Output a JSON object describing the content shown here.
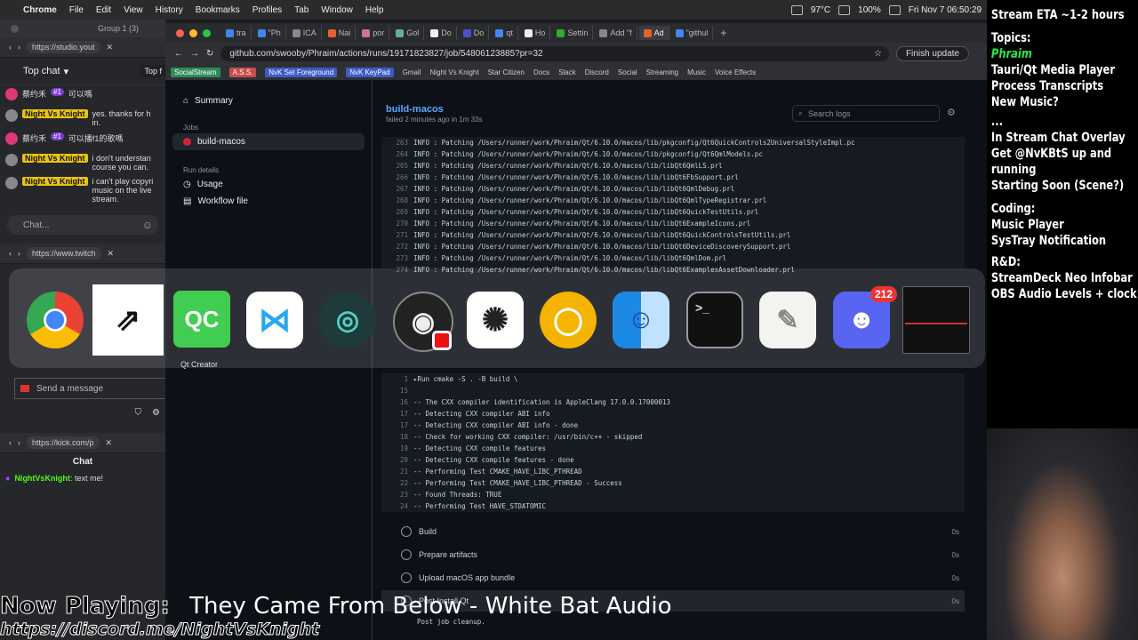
{
  "menubar": {
    "items": [
      "Chrome",
      "File",
      "Edit",
      "View",
      "History",
      "Bookmarks",
      "Profiles",
      "Tab",
      "Window",
      "Help"
    ],
    "temp": "97°C",
    "battery": "100%",
    "datetime": "Fri Nov 7  06:50:29"
  },
  "left": {
    "group_label": "Group 1 (3)",
    "url1": "https://studio.yout",
    "top_chat": "Top chat",
    "top_chat2": "Top f",
    "chat_msgs": [
      {
        "user": "蔡约禾",
        "badge": "#1",
        "text": "可以嗎"
      },
      {
        "user": "Night Vs Knight",
        "text": "yes. thanks for h in."
      },
      {
        "user": "蔡约禾",
        "badge": "#1",
        "text": "可以播f1的歌嗎"
      },
      {
        "user": "Night Vs Knight",
        "text": "i don't understan course you can."
      },
      {
        "user": "Night Vs Knight",
        "text": "i can't play copyri music on the live stream."
      }
    ],
    "chat_placeholder": "Chat...",
    "url2": "https://www.twitch",
    "send_placeholder": "Send a message",
    "url3": "https://kick.com/p",
    "kick_chat_title": "Chat",
    "kick_user": "NightVsKnight",
    "kick_msg": ": text me!"
  },
  "tabs": [
    "tra",
    "\"Ph",
    "ICA",
    "Nai",
    "por",
    "Gol",
    "Do",
    "Do",
    "qt",
    "Ho",
    "Settin",
    "Add \"f",
    "Ad",
    "\"githul"
  ],
  "address": {
    "url": "github.com/swooby/Phraim/actions/runs/19171823827/job/54806123885?pr=32",
    "finish_update": "Finish update"
  },
  "bookmarks": [
    "SocialStream",
    "A.S.S.",
    "NvK Set Foreground",
    "NvK KeyPad",
    "Gmail",
    "Night Vs Knight",
    "Star Citizen",
    "Docs",
    "Slack",
    "Discord",
    "Social",
    "Streaming",
    "Music",
    "Voice Effects"
  ],
  "gh": {
    "summary": "Summary",
    "jobs_heading": "Jobs",
    "job_name": "build-macos",
    "run_details": "Run details",
    "usage": "Usage",
    "workflow_file": "Workflow file",
    "job_title": "build-macos",
    "job_sub": "failed 2 minutes ago in 1m 33s",
    "search_placeholder": "Search logs",
    "log_top": [
      {
        "n": "263",
        "t": "INFO    : Patching /Users/runner/work/Phraim/Qt/6.10.0/macos/lib/pkgconfig/Qt6QuickControls2UniversalStyleImpl.pc"
      },
      {
        "n": "264",
        "t": "INFO    : Patching /Users/runner/work/Phraim/Qt/6.10.0/macos/lib/pkgconfig/Qt6QmlModels.pc"
      },
      {
        "n": "265",
        "t": "INFO    : Patching /Users/runner/work/Phraim/Qt/6.10.0/macos/lib/libQt6QmlLS.prl"
      },
      {
        "n": "266",
        "t": "INFO    : Patching /Users/runner/work/Phraim/Qt/6.10.0/macos/lib/libQt6FbSupport.prl"
      },
      {
        "n": "267",
        "t": "INFO    : Patching /Users/runner/work/Phraim/Qt/6.10.0/macos/lib/libQt6QmlDebug.prl"
      },
      {
        "n": "268",
        "t": "INFO    : Patching /Users/runner/work/Phraim/Qt/6.10.0/macos/lib/libQt6QmlTypeRegistrar.prl"
      },
      {
        "n": "269",
        "t": "INFO    : Patching /Users/runner/work/Phraim/Qt/6.10.0/macos/lib/libQt6QuickTestUtils.prl"
      },
      {
        "n": "270",
        "t": "INFO    : Patching /Users/runner/work/Phraim/Qt/6.10.0/macos/lib/libQt6ExampleIcons.prl"
      },
      {
        "n": "271",
        "t": "INFO    : Patching /Users/runner/work/Phraim/Qt/6.10.0/macos/lib/libQt6QuickControlsTestUtils.prl"
      },
      {
        "n": "272",
        "t": "INFO    : Patching /Users/runner/work/Phraim/Qt/6.10.0/macos/lib/libQt6DeviceDiscoverySupport.prl"
      },
      {
        "n": "273",
        "t": "INFO    : Patching /Users/runner/work/Phraim/Qt/6.10.0/macos/lib/libQt6QmlDom.prl"
      },
      {
        "n": "274",
        "t": "INFO    : Patching /Users/runner/work/Phraim/Qt/6.10.0/macos/lib/libQt6ExamplesAssetDownloader.prl"
      }
    ],
    "log_bottom": [
      {
        "n": "1",
        "t": "▸Run cmake -S . -B build \\"
      },
      {
        "n": "15",
        "t": ""
      },
      {
        "n": "16",
        "t": "-- The CXX compiler identification is AppleClang 17.0.0.17000013"
      },
      {
        "n": "17",
        "t": "-- Detecting CXX compiler ABI info"
      },
      {
        "n": "17",
        "t": "-- Detecting CXX compiler ABI info - done"
      },
      {
        "n": "18",
        "t": "-- Check for working CXX compiler: /usr/bin/c++ - skipped"
      },
      {
        "n": "19",
        "t": "-- Detecting CXX compile features"
      },
      {
        "n": "20",
        "t": "-- Detecting CXX compile features - done"
      },
      {
        "n": "21",
        "t": "-- Performing Test CMAKE_HAVE_LIBC_PTHREAD"
      },
      {
        "n": "22",
        "t": "-- Performing Test CMAKE_HAVE_LIBC_PTHREAD - Success"
      },
      {
        "n": "23",
        "t": "-- Found Threads: TRUE"
      },
      {
        "n": "24",
        "t": "-- Performing Test HAVE_STDATOMIC"
      }
    ],
    "steps": [
      {
        "name": "Build",
        "time": "0s"
      },
      {
        "name": "Prepare artifacts",
        "time": "0s"
      },
      {
        "name": "Upload macOS app bundle",
        "time": "0s"
      },
      {
        "name": "Post Install Qt",
        "time": "0s"
      }
    ],
    "post_cleanup": "Post job cleanup."
  },
  "switcher": {
    "selected_label": "Qt Creator",
    "discord_badge": "212"
  },
  "overlay": {
    "lines": [
      {
        "text": "Stream ETA ~1-2 hours",
        "cls": "h"
      },
      {
        "text": "Topics:",
        "cls": "h"
      },
      {
        "text": "Phraim",
        "cls": "g"
      },
      {
        "text": "Tauri/Qt Media Player",
        "cls": ""
      },
      {
        "text": "Process Transcripts",
        "cls": ""
      },
      {
        "text": "New Music?",
        "cls": ""
      },
      {
        "text": "...",
        "cls": ""
      },
      {
        "text": "In Stream Chat Overlay",
        "cls": ""
      },
      {
        "text": "Get @NvKBtS up and",
        "cls": ""
      },
      {
        "text": "running",
        "cls": ""
      },
      {
        "text": "Starting Soon (Scene?)",
        "cls": ""
      },
      {
        "text": "Coding:",
        "cls": "h"
      },
      {
        "text": "Music Player",
        "cls": ""
      },
      {
        "text": "SysTray Notification",
        "cls": ""
      },
      {
        "text": "R&D:",
        "cls": "h"
      },
      {
        "text": "StreamDeck Neo Infobar",
        "cls": ""
      },
      {
        "text": "OBS Audio Levels + clock",
        "cls": ""
      }
    ]
  },
  "ticker": {
    "label": "Now Playing:",
    "song": "They Came From Below - White Bat Audio",
    "discord": "https://discord.me/NightVsKnight"
  }
}
